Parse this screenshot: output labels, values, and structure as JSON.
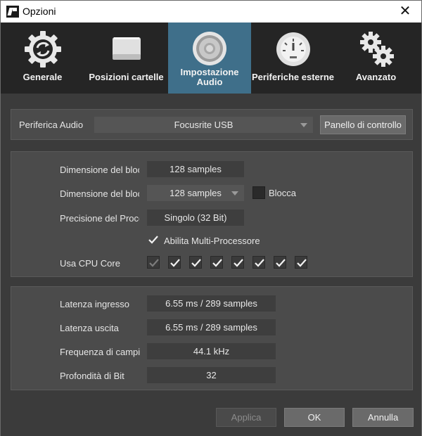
{
  "window": {
    "title": "Opzioni",
    "close_glyph": "✕"
  },
  "toolbar": {
    "items": [
      {
        "label": "Generale",
        "icon": "sync-gear-icon",
        "active": false
      },
      {
        "label": "Posizioni cartelle",
        "icon": "hard-drive-icon",
        "active": false
      },
      {
        "label_line1": "Impostazione",
        "label_line2": "Audio",
        "icon": "speaker-icon",
        "active": true
      },
      {
        "label": "Periferiche esterne",
        "icon": "gauge-icon",
        "active": false
      },
      {
        "label": "Avanzato",
        "icon": "gears-icon",
        "active": false
      }
    ]
  },
  "device_panel": {
    "label": "Periferica Audio",
    "device": "Focusrite USB",
    "control_panel_button": "Panello di controllo"
  },
  "processing_panel": {
    "buffer_label_1": "Dimensione del bloc",
    "buffer_value_1": "128 samples",
    "buffer_label_2": "Dimensione del bloc",
    "buffer_value_2": "128 samples",
    "lock_label": "Blocca",
    "precision_label": "Precisione del Proce",
    "precision_value": "Singolo (32 Bit)",
    "multiprocessor_label": "Abilita Multi-Processore",
    "cpu_label": "Usa CPU Core",
    "cpu_cores": [
      {
        "checked": true,
        "enabled": false
      },
      {
        "checked": true,
        "enabled": true
      },
      {
        "checked": true,
        "enabled": true
      },
      {
        "checked": true,
        "enabled": true
      },
      {
        "checked": true,
        "enabled": true
      },
      {
        "checked": true,
        "enabled": true
      },
      {
        "checked": true,
        "enabled": true
      },
      {
        "checked": true,
        "enabled": true
      }
    ]
  },
  "info_panel": {
    "input_latency_label": "Latenza ingresso",
    "input_latency_value": "6.55 ms / 289 samples",
    "output_latency_label": "Latenza uscita",
    "output_latency_value": "6.55 ms / 289 samples",
    "sample_rate_label": "Frequenza di campi",
    "sample_rate_value": "44.1 kHz",
    "bit_depth_label": "Profondità di Bit",
    "bit_depth_value": "32"
  },
  "footer": {
    "apply": "Applica",
    "ok": "OK",
    "cancel": "Annulla"
  }
}
